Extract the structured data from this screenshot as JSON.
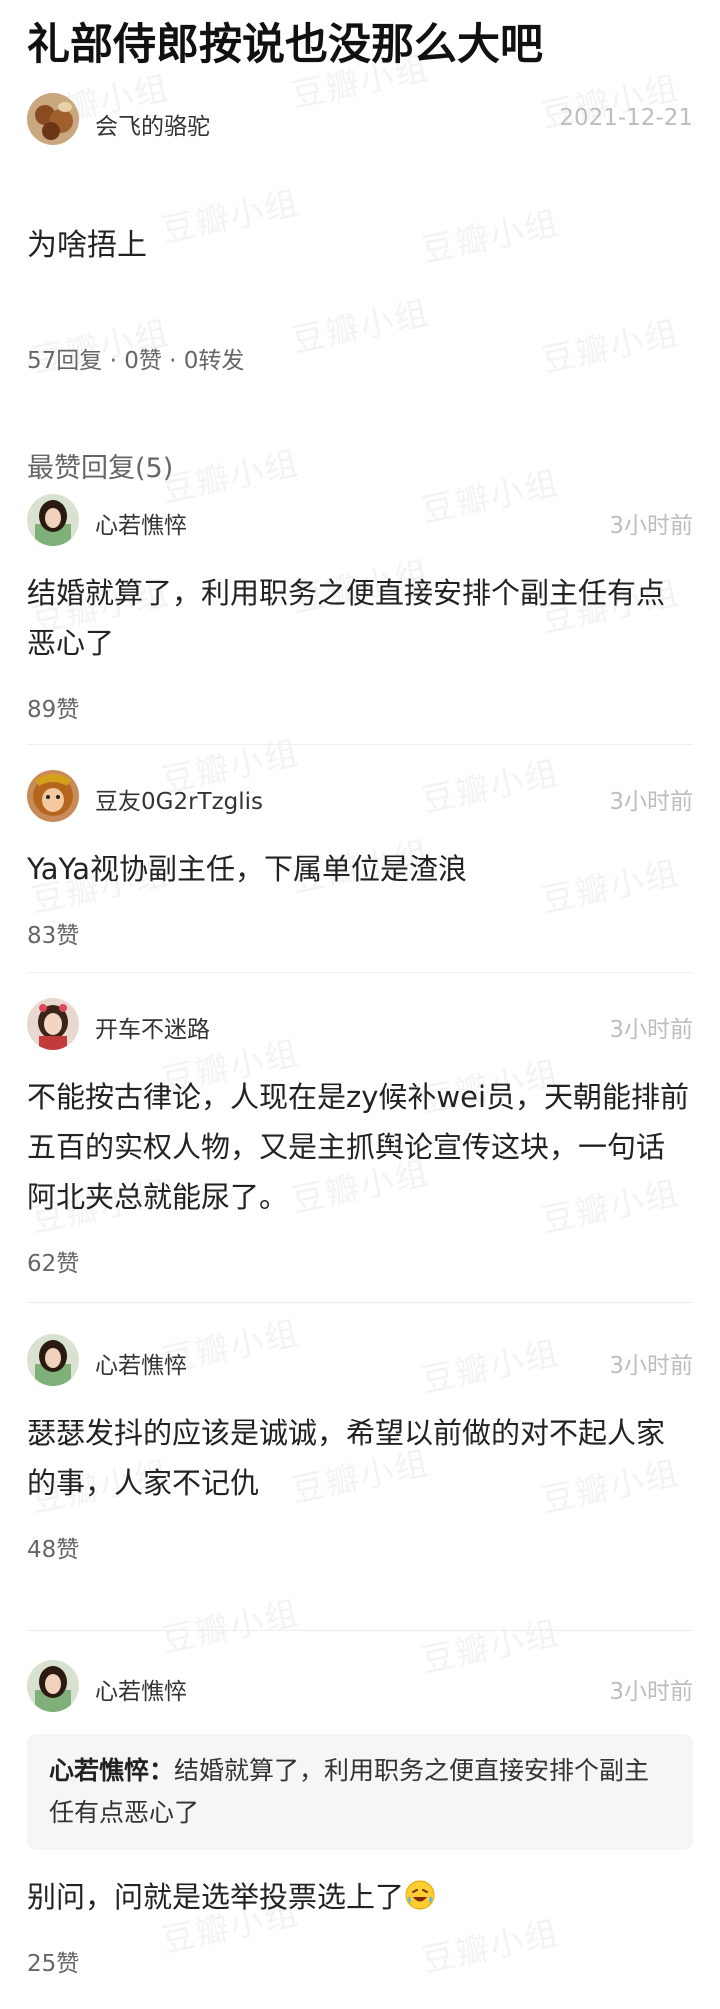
{
  "post": {
    "title": "礼部侍郎按说也没那么大吧",
    "author": "会飞的骆驼",
    "date": "2021-12-21",
    "body": "为啥捂上",
    "stats": "57回复 · 0赞 · 0转发"
  },
  "watermark_text": "豆瓣小组",
  "section_header": "最赞回复(5)",
  "comments": [
    {
      "name": "心若憔悴",
      "time": "3小时前",
      "text": "结婚就算了，利用职务之便直接安排个副主任有点恶心了",
      "likes": "89赞"
    },
    {
      "name": "豆友0G2rTzglis",
      "time": "3小时前",
      "text": "YaYa视协副主任，下属单位是渣浪",
      "likes": "83赞"
    },
    {
      "name": "开车不迷路",
      "time": "3小时前",
      "text": "不能按古律论，人现在是zy候补wei员，天朝能排前五百的实权人物，又是主抓舆论宣传这块，一句话阿北夹总就能尿了。",
      "likes": "62赞"
    },
    {
      "name": "心若憔悴",
      "time": "3小时前",
      "text": "瑟瑟发抖的应该是诚诚，希望以前做的对不起人家的事，人家不记仇",
      "likes": "48赞"
    },
    {
      "name": "心若憔悴",
      "time": "3小时前",
      "quote_name": "心若憔悴：",
      "quote_text": "结婚就算了，利用职务之便直接安排个副主任有点恶心了",
      "text": "别问，问就是选举投票选上了",
      "emoji": "laughing-crying-emoji",
      "likes": "25赞"
    }
  ]
}
